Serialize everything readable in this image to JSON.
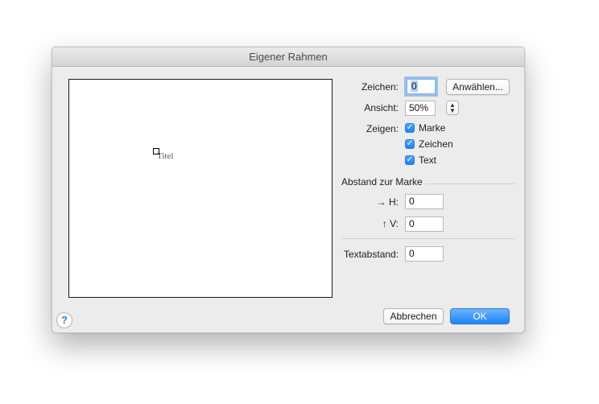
{
  "window": {
    "title": "Eigener Rahmen"
  },
  "preview": {
    "mark_title": "Titel"
  },
  "zeichen": {
    "label": "Zeichen:",
    "value": "0",
    "select_button": "Anwählen..."
  },
  "ansicht": {
    "label": "Ansicht:",
    "value": "50%"
  },
  "zeigen": {
    "label": "Zeigen:",
    "options": [
      {
        "label": "Marke",
        "checked": true
      },
      {
        "label": "Zeichen",
        "checked": true
      },
      {
        "label": "Text",
        "checked": true
      }
    ]
  },
  "abstand": {
    "section_title": "Abstand zur Marke",
    "h_label": "→ H:",
    "h_value": "0",
    "v_label": "↑ V:",
    "v_value": "0"
  },
  "textabstand": {
    "label": "Textabstand:",
    "value": "0"
  },
  "buttons": {
    "cancel": "Abbrechen",
    "ok": "OK",
    "help": "?"
  },
  "colors": {
    "accent": "#1c84f7",
    "window_bg": "#ececec"
  }
}
